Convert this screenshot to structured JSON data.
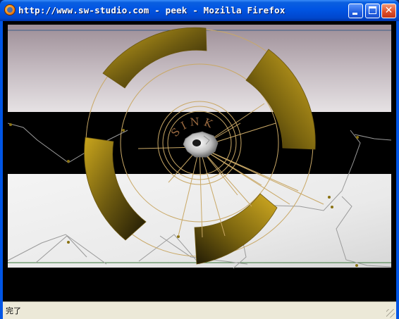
{
  "window": {
    "title": "http://www.sw-studio.com - peek - Mozilla Firefox",
    "icon": "firefox-icon",
    "controls": [
      "minimize-icon",
      "maximize-icon",
      "close-icon"
    ]
  },
  "content": {
    "sink_label": "SINK",
    "colors": {
      "gold": "#8a7212",
      "thin_line": "#c9a866",
      "gray_line": "#9a9a9a",
      "band_dark": "#000000",
      "band_light_top": "#a89aa2",
      "band_light_bottom": "#eeeeee"
    }
  },
  "statusbar": {
    "text": "完了"
  }
}
